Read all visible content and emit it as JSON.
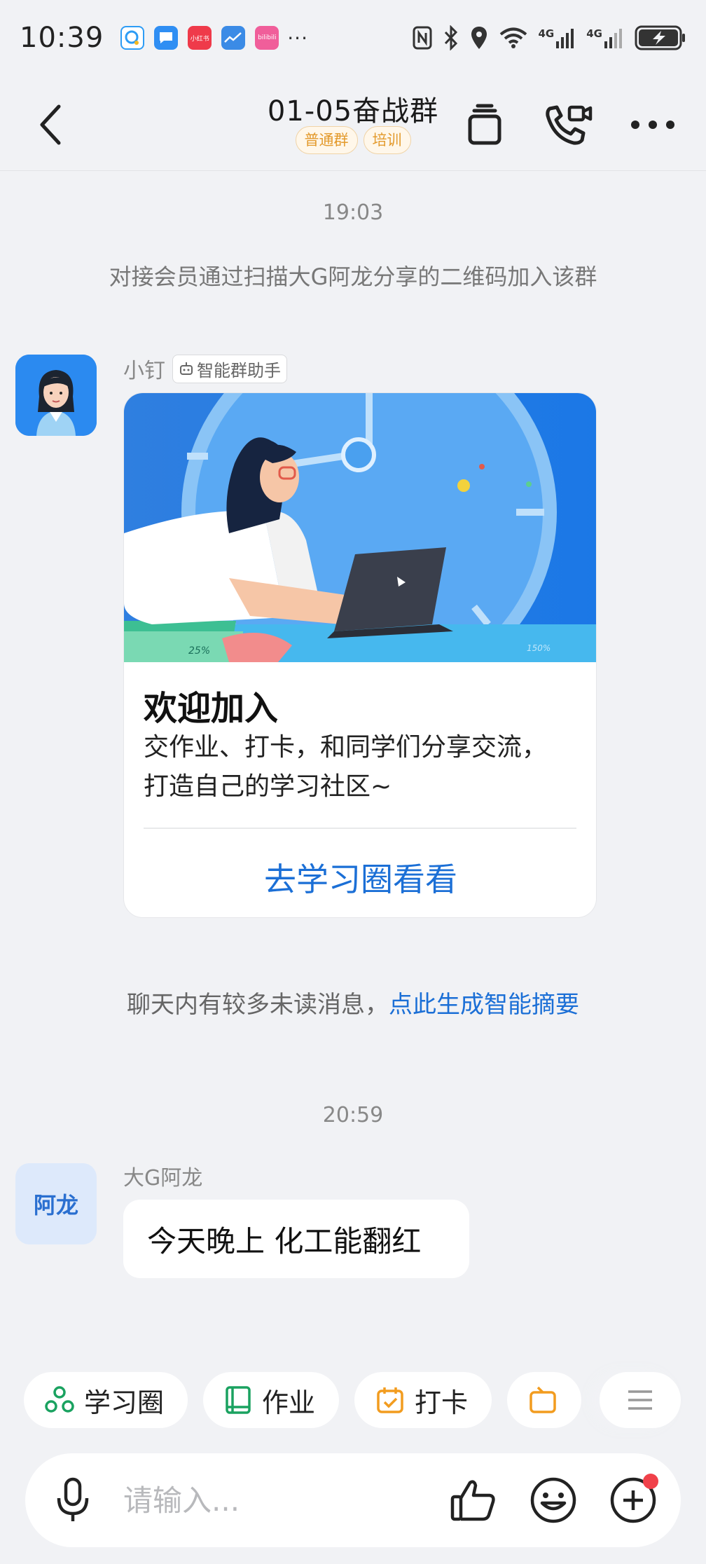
{
  "status_bar": {
    "time": "10:39",
    "more": "···",
    "net1": "4G",
    "net2": "4G",
    "apps": [
      {
        "name": "qq-browser",
        "color": "#2d9cf5",
        "label": ""
      },
      {
        "name": "messages",
        "color": "#2f8ef3",
        "label": ""
      },
      {
        "name": "xiaohongshu",
        "color": "#ef3a4a",
        "label": "小红书"
      },
      {
        "name": "stocks",
        "color": "#3b8be6",
        "label": ""
      },
      {
        "name": "bilibili",
        "color": "#f05e9a",
        "label": "bilibili"
      }
    ]
  },
  "header": {
    "title": "01-05奋战群",
    "tags": [
      "普通群",
      "培训"
    ]
  },
  "messages": {
    "time1": "19:03",
    "system_join": "对接会员通过扫描大G阿龙分享的二维码加入该群",
    "bot_name": "小钉",
    "bot_tag": "智能群助手",
    "card": {
      "title": "欢迎加入",
      "desc": "交作业、打卡，和同学们分享交流，打造自己的学习社区~",
      "link": "去学习圈看看",
      "badge_left": "25%",
      "badge_right": "150%"
    },
    "unread_text": "聊天内有较多未读消息，",
    "unread_link": "点此生成智能摘要",
    "time2": "20:59",
    "sender2_name": "大G阿龙",
    "sender2_avatar": "阿龙",
    "sender2_text": "今天晚上 化工能翻红"
  },
  "quick_actions": [
    {
      "label": "学习圈",
      "icon": "circle-group-icon",
      "color": "#1aa260"
    },
    {
      "label": "作业",
      "icon": "book-icon",
      "color": "#1aa260"
    },
    {
      "label": "打卡",
      "icon": "calendar-check-icon",
      "color": "#f29c1f"
    }
  ],
  "input": {
    "placeholder": "请输入..."
  },
  "colors": {
    "accent": "#1b6fd6",
    "tag_text": "#e39a2c",
    "notify": "#f0414a"
  }
}
